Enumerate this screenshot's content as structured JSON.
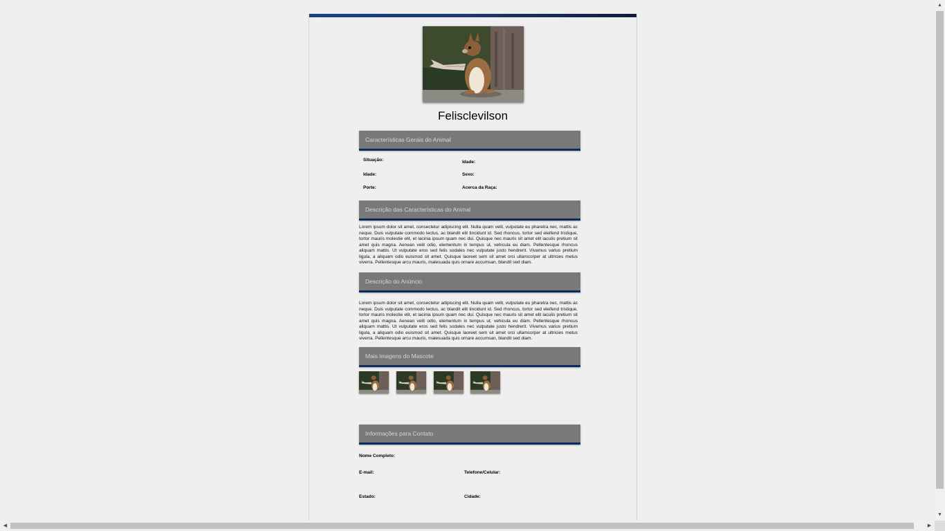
{
  "pet": {
    "name": "Felisclevilson"
  },
  "sections": {
    "general": {
      "title": "Características Gerais do Animal"
    },
    "description": {
      "title": "Descrição das Características do Animal",
      "text": "Lorem ipsum dolor sit amet, consectetur adipiscing elit. Nulla quam velit, vulputate eu pharetra nec, mattis ac neque. Duis vulputate commodo lectus, ac blandit elit tincidunt id. Sed rhoncus, tortor sed eleifend tristique, tortor mauris molestie elit, et lacinia ipsum quam nec dui. Quisque nec mauris sit amet elit iaculis pretium sit amet quis magna. Aenean velit odio, elementum in tempus ut, vehicula eu diam. Pellentesque rhoncus aliquam mattis. Ut vulputate eros sed felis sodales nec vulputate justo hendrerit. Vivamus varius pretium ligula, a aliquam odio euismod sit amet. Quisque laoreet sem sit amet orci ullamcorper at ultricies metus viverra. Pellentesque arcu mauris, malesuada quis ornare accumsan, blandit sed diam."
    },
    "ad": {
      "title": "Descrição do Anúncio",
      "text": "Lorem ipsum dolor sit amet, consectetur adipiscing elit. Nulla quam velit, vulputate eu pharetra nec, mattis ac neque. Duis vulputate commodo lectus, ac blandit elit tincidunt id. Sed rhoncus, tortor sed eleifend tristique, tortor mauris molestie elit, et lacinia ipsum quam nec dui. Quisque nec mauris sit amet elit iaculis pretium sit amet quis magna. Aenean velit odio, elementum in tempus ut, vehicula eu diam. Pellentesque rhoncus aliquam mattis. Ut vulputate eros sed felis sodales nec vulputate justo hendrerit. Vivamus varius pretium ligula, a aliquam odio euismod sit amet. Quisque laoreet sem sit amet orci ullamcorper at ultricies metus viverra. Pellentesque arcu mauris, malesuada quis ornare accumsan, blandit sed diam."
    },
    "gallery": {
      "title": "Mais imagens do Mascote"
    },
    "contact": {
      "title": "Informações para Contato"
    }
  },
  "general_fields": {
    "situacao": "Situação:",
    "idade_left": "Idade:",
    "idade_right": "Idade:",
    "sexo": "Sexo:",
    "porte": "Porte:",
    "raca": "Acerca da Raça:"
  },
  "contact_fields": {
    "nome": "Nome Completo:",
    "email": "E-mail:",
    "telefone": "Telefone/Celular:",
    "estado": "Estado:",
    "cidade": "Cidade:"
  },
  "colors": {
    "accent": "#1b3f86",
    "section_header": "#797979",
    "section_border": "#0f2b5e",
    "background": "#efefef"
  }
}
